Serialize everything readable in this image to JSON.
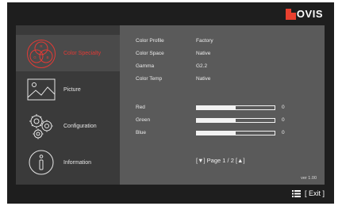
{
  "brand": {
    "name": "OVIS",
    "accent": "#e8402f"
  },
  "menu": [
    {
      "label": "Color Specialty",
      "icon": "color-rgb-icon",
      "active": true
    },
    {
      "label": "Picture",
      "icon": "picture-icon",
      "active": false
    },
    {
      "label": "Configuration",
      "icon": "gears-icon",
      "active": false
    },
    {
      "label": "Information",
      "icon": "info-icon",
      "active": false
    }
  ],
  "icon_letters": {
    "r": "R",
    "g": "G",
    "b": "B"
  },
  "settings": [
    {
      "label": "Color Profile",
      "value": "Factory"
    },
    {
      "label": "Color Space",
      "value": "Native"
    },
    {
      "label": "Gamma",
      "value": "G2.2"
    },
    {
      "label": "Color Temp",
      "value": "Native"
    }
  ],
  "sliders": [
    {
      "label": "Red",
      "value": "0",
      "level": 0.5
    },
    {
      "label": "Green",
      "value": "0",
      "level": 0.5
    },
    {
      "label": "Blue",
      "value": "0",
      "level": 0.5
    }
  ],
  "pager": {
    "text": "[▼] Page 1 / 2 [▲]"
  },
  "version": "ver 1.00",
  "footer": {
    "exit_label": "[ Exit ]",
    "exit_icon": "list-icon"
  },
  "colors": {
    "active_text": "#e23a35",
    "sidebar_bg": "#3a3a3a",
    "content_bg": "#5a5a5a",
    "frame_bg": "#1e1e1e"
  }
}
